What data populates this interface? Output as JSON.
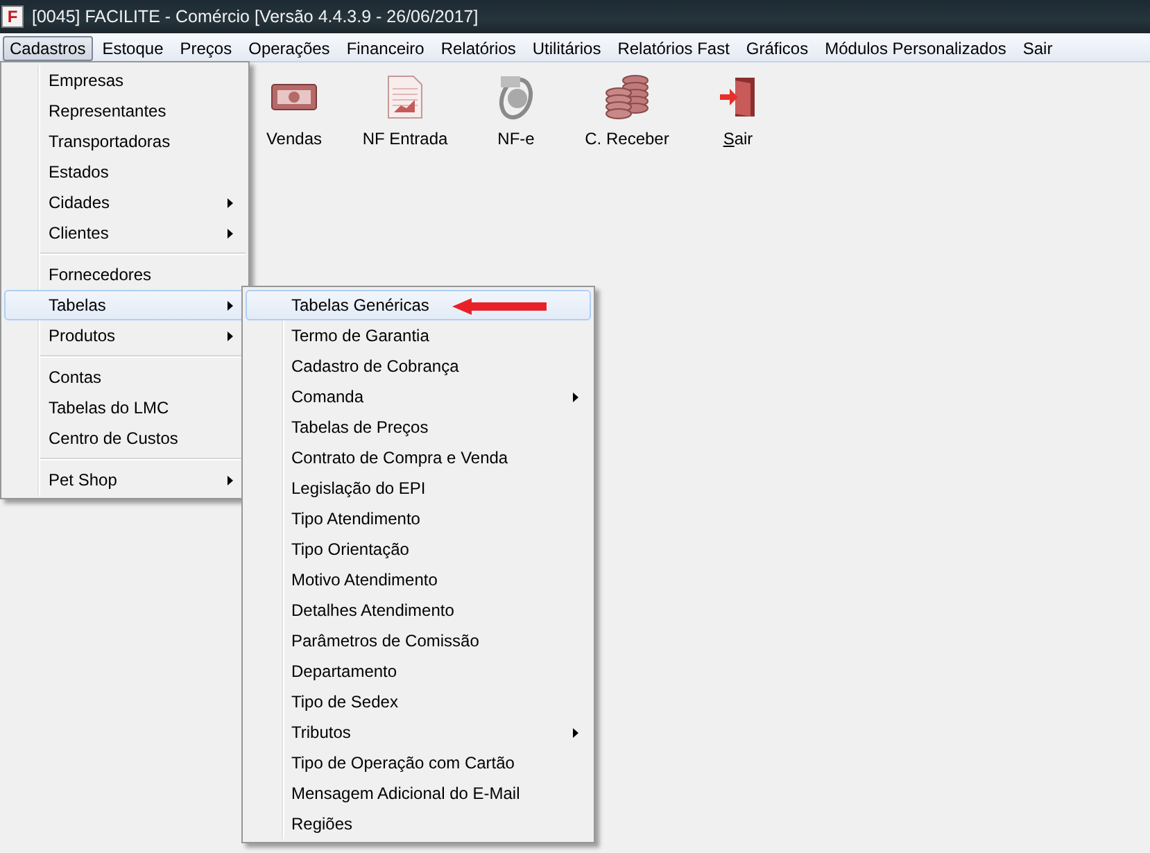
{
  "window": {
    "icon_letter": "F",
    "title": "[0045] FACILITE - Comércio [Versão 4.4.3.9 - 26/06/2017]"
  },
  "menu_bar": [
    {
      "label": "Cadastros",
      "selected": true
    },
    {
      "label": "Estoque",
      "selected": false
    },
    {
      "label": "Preços",
      "selected": false
    },
    {
      "label": "Operações",
      "selected": false
    },
    {
      "label": "Financeiro",
      "selected": false
    },
    {
      "label": "Relatórios",
      "selected": false
    },
    {
      "label": "Utilitários",
      "selected": false
    },
    {
      "label": "Relatórios Fast",
      "selected": false
    },
    {
      "label": "Gráficos",
      "selected": false
    },
    {
      "label": "Módulos Personalizados",
      "selected": false
    },
    {
      "label": "Sair",
      "selected": false
    }
  ],
  "toolbar": [
    {
      "kind": "money",
      "label": "Vendas"
    },
    {
      "kind": "document",
      "label": "NF Entrada"
    },
    {
      "kind": "nfe",
      "label": "NF-e"
    },
    {
      "kind": "coins",
      "label": "C. Receber"
    },
    {
      "kind": "exit",
      "label": "Sair"
    }
  ],
  "menu": [
    {
      "kind": "item",
      "label": "Empresas",
      "submenu": false,
      "selected": false
    },
    {
      "kind": "item",
      "label": "Representantes",
      "submenu": false,
      "selected": false
    },
    {
      "kind": "item",
      "label": "Transportadoras",
      "submenu": false,
      "selected": false
    },
    {
      "kind": "item",
      "label": "Estados",
      "submenu": false,
      "selected": false
    },
    {
      "kind": "item",
      "label": "Cidades",
      "submenu": true,
      "selected": false
    },
    {
      "kind": "item",
      "label": "Clientes",
      "submenu": true,
      "selected": false
    },
    {
      "kind": "separator"
    },
    {
      "kind": "item",
      "label": "Fornecedores",
      "submenu": false,
      "selected": false
    },
    {
      "kind": "item",
      "label": "Tabelas",
      "submenu": true,
      "selected": true
    },
    {
      "kind": "item",
      "label": "Produtos",
      "submenu": true,
      "selected": false
    },
    {
      "kind": "separator"
    },
    {
      "kind": "item",
      "label": "Contas",
      "submenu": false,
      "selected": false
    },
    {
      "kind": "item",
      "label": "Tabelas do LMC",
      "submenu": false,
      "selected": false
    },
    {
      "kind": "item",
      "label": "Centro de Custos",
      "submenu": false,
      "selected": false
    },
    {
      "kind": "separator"
    },
    {
      "kind": "item",
      "label": "Pet Shop",
      "submenu": true,
      "selected": false
    }
  ],
  "submenu": [
    {
      "kind": "item",
      "label": "Tabelas Genéricas",
      "submenu": false,
      "selected": true,
      "pointer_arrow": true
    },
    {
      "kind": "item",
      "label": "Termo de Garantia",
      "submenu": false,
      "selected": false
    },
    {
      "kind": "item",
      "label": "Cadastro de Cobrança",
      "submenu": false,
      "selected": false
    },
    {
      "kind": "item",
      "label": "Comanda",
      "submenu": true,
      "selected": false
    },
    {
      "kind": "item",
      "label": "Tabelas de Preços",
      "submenu": false,
      "selected": false
    },
    {
      "kind": "item",
      "label": "Contrato de Compra e Venda",
      "submenu": false,
      "selected": false
    },
    {
      "kind": "item",
      "label": "Legislação do EPI",
      "submenu": false,
      "selected": false
    },
    {
      "kind": "item",
      "label": "Tipo Atendimento",
      "submenu": false,
      "selected": false
    },
    {
      "kind": "item",
      "label": "Tipo Orientação",
      "submenu": false,
      "selected": false
    },
    {
      "kind": "item",
      "label": "Motivo Atendimento",
      "submenu": false,
      "selected": false
    },
    {
      "kind": "item",
      "label": "Detalhes Atendimento",
      "submenu": false,
      "selected": false
    },
    {
      "kind": "item",
      "label": "Parâmetros de Comissão",
      "submenu": false,
      "selected": false
    },
    {
      "kind": "item",
      "label": "Departamento",
      "submenu": false,
      "selected": false
    },
    {
      "kind": "item",
      "label": "Tipo de Sedex",
      "submenu": false,
      "selected": false
    },
    {
      "kind": "item",
      "label": "Tributos",
      "submenu": true,
      "selected": false
    },
    {
      "kind": "item",
      "label": "Tipo de Operação com Cartão",
      "submenu": false,
      "selected": false
    },
    {
      "kind": "item",
      "label": "Mensagem Adicional do E-Mail",
      "submenu": false,
      "selected": false
    },
    {
      "kind": "item",
      "label": "Regiões",
      "submenu": false,
      "selected": false
    }
  ]
}
